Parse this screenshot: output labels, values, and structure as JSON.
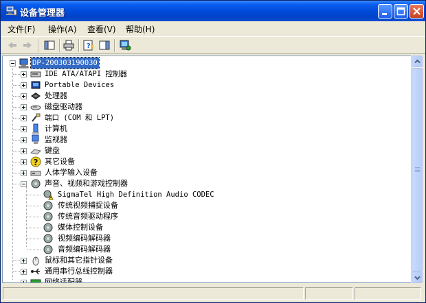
{
  "window": {
    "title": "设备管理器"
  },
  "menu": [
    "文件(F)",
    "操作(A)",
    "查看(V)",
    "帮助(H)"
  ],
  "toolbar": {
    "buttons": [
      "back-icon",
      "forward-icon",
      "properties-pane-icon",
      "print-icon",
      "help-icon",
      "console-tree-icon",
      "scan-hardware-icon"
    ]
  },
  "tree": {
    "root": "DP-200303190030",
    "categories": [
      {
        "label": "IDE ATA/ATAPI 控制器",
        "icon": "ide-icon"
      },
      {
        "label": "Portable Devices",
        "icon": "portable-device-icon"
      },
      {
        "label": "处理器",
        "icon": "processor-icon"
      },
      {
        "label": "磁盘驱动器",
        "icon": "disk-drive-icon"
      },
      {
        "label": "端口 (COM 和 LPT)",
        "icon": "port-icon"
      },
      {
        "label": "计算机",
        "icon": "computer-icon"
      },
      {
        "label": "监视器",
        "icon": "monitor-icon"
      },
      {
        "label": "键盘",
        "icon": "keyboard-icon"
      },
      {
        "label": "其它设备",
        "icon": "unknown-device-icon"
      },
      {
        "label": "人体学输入设备",
        "icon": "hid-icon"
      },
      {
        "label": "声音、视频和游戏控制器",
        "icon": "sound-icon",
        "expanded": true,
        "children": [
          {
            "label": "SigmaTel High Definition Audio CODEC",
            "icon": "warning-device-icon"
          },
          {
            "label": "传统视频捕捉设备",
            "icon": "sound-device-icon"
          },
          {
            "label": "传统音频驱动程序",
            "icon": "sound-device-icon"
          },
          {
            "label": "媒体控制设备",
            "icon": "sound-device-icon"
          },
          {
            "label": "视频编码解码器",
            "icon": "sound-device-icon"
          },
          {
            "label": "音频编码解码器",
            "icon": "sound-device-icon"
          }
        ]
      },
      {
        "label": "鼠标和其它指针设备",
        "icon": "mouse-icon"
      },
      {
        "label": "通用串行总线控制器",
        "icon": "usb-icon"
      },
      {
        "label": "网络适配器",
        "icon": "network-adapter-icon"
      }
    ]
  }
}
